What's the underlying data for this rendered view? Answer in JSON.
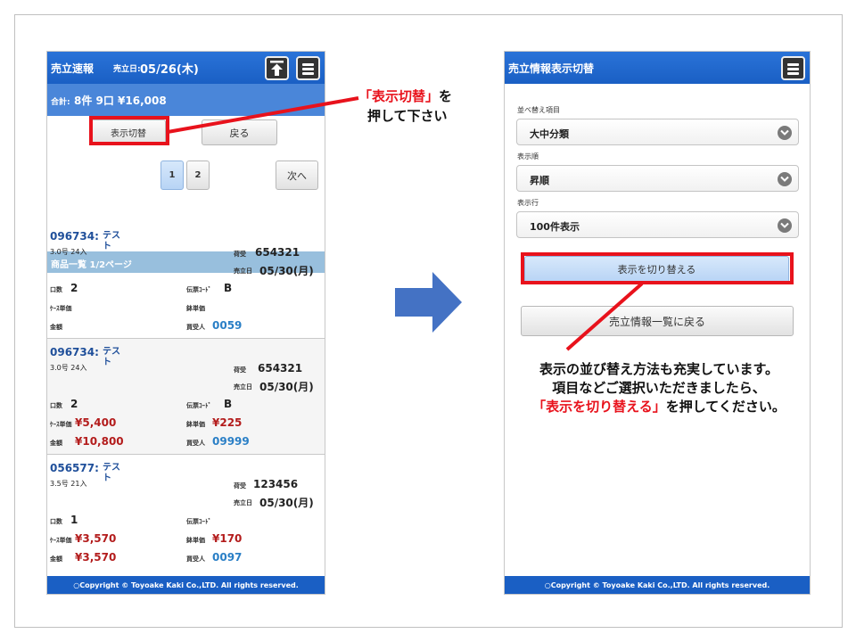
{
  "phone1": {
    "header": {
      "title": "売立速報",
      "date_label": "売立日:",
      "date_value": "05/26(木)"
    },
    "summary": {
      "label": "合計:",
      "value": "8件 9口 ¥16,008"
    },
    "buttons": {
      "toggle": "表示切替",
      "back": "戻る",
      "next": "次へ"
    },
    "pages": [
      "1",
      "2"
    ],
    "section_title": "商品一覧 1/2ページ",
    "items": [
      {
        "code": "096734:",
        "name1": "テス",
        "name2": "ト",
        "spec": "3.0号 24入",
        "ship_label": "荷受",
        "ship_value": "654321",
        "date_label": "売立日",
        "date_value": "05/30(月)",
        "qty_label": "口数",
        "qty_value": "2",
        "slip_label": "伝票ｺｰﾄﾞ",
        "slip_value": "B",
        "case_label": "ｹｰｽ単価",
        "case_value": "",
        "unit_label": "鉢単価",
        "unit_value": "",
        "amount_label": "金額",
        "amount_value": "",
        "buyer_label": "買受人",
        "buyer_value": "0059"
      },
      {
        "code": "096734:",
        "name1": "テス",
        "name2": "ト",
        "spec": "3.0号 24入",
        "ship_label": "荷受",
        "ship_value": "654321",
        "date_label": "売立日",
        "date_value": "05/30(月)",
        "qty_label": "口数",
        "qty_value": "2",
        "slip_label": "伝票ｺｰﾄﾞ",
        "slip_value": "B",
        "case_label": "ｹｰｽ単価",
        "case_value": "¥5,400",
        "unit_label": "鉢単価",
        "unit_value": "¥225",
        "amount_label": "金額",
        "amount_value": "¥10,800",
        "buyer_label": "買受人",
        "buyer_value": "09999"
      },
      {
        "code": "056577:",
        "name1": "テス",
        "name2": "ト",
        "spec": "3.5号 21入",
        "ship_label": "荷受",
        "ship_value": "123456",
        "date_label": "売立日",
        "date_value": "05/30(月)",
        "qty_label": "口数",
        "qty_value": "1",
        "slip_label": "伝票ｺｰﾄﾞ",
        "slip_value": "",
        "case_label": "ｹｰｽ単価",
        "case_value": "¥3,570",
        "unit_label": "鉢単価",
        "unit_value": "¥170",
        "amount_label": "金額",
        "amount_value": "¥3,570",
        "buyer_label": "買受人",
        "buyer_value": "0097"
      }
    ],
    "footer": "○Copyright © Toyoake Kaki Co.,LTD. All rights reserved."
  },
  "phone2": {
    "header": {
      "title": "売立情報表示切替"
    },
    "fields": [
      {
        "label": "並べ替え項目",
        "value": "大中分類"
      },
      {
        "label": "表示順",
        "value": "昇順"
      },
      {
        "label": "表示行",
        "value": "100件表示"
      }
    ],
    "buttons": {
      "apply": "表示を切り替える",
      "back": "売立情報一覧に戻る"
    },
    "footer": "○Copyright © Toyoake Kaki Co.,LTD. All rights reserved."
  },
  "callout1": {
    "quote": "「表示切替」",
    "tail": "を",
    "line2": "押して下さい"
  },
  "callout2": {
    "line1": "表示の並び替え方法も充実しています。",
    "line2": "項目などご選択いただきましたら、",
    "line3_red": "「表示を切り替える」",
    "line3_tail": "を押してください。"
  },
  "colors": {
    "accent_red": "#e8121c",
    "header_blue": "#1a5fc4",
    "arrow_blue": "#4472c4"
  },
  "icons": [
    "scroll-top-icon",
    "menu-icon",
    "chevron-down-icon",
    "right-arrow-icon"
  ]
}
